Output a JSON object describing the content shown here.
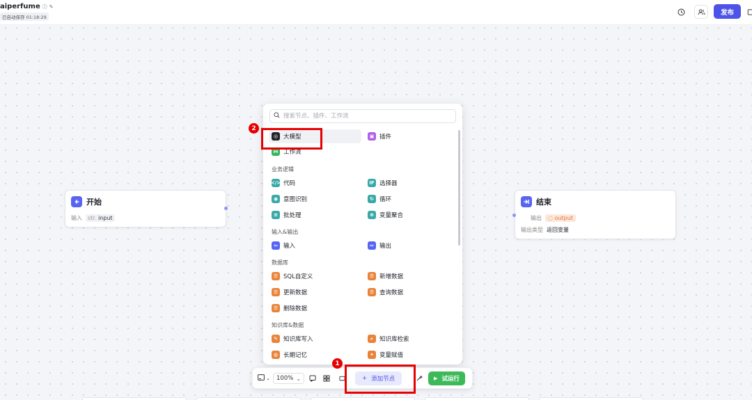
{
  "header": {
    "title": "aiperfume",
    "title_info_icon": "info-icon",
    "title_edit_icon": "edit-icon",
    "autosave": "已自动保存 01:18:29",
    "history_icon": "clock-icon",
    "members_icon": "users-icon",
    "publish_label": "发布"
  },
  "nodes": {
    "start": {
      "title": "开始",
      "input_label": "输入",
      "input_type": "str.",
      "input_name": "input"
    },
    "end": {
      "title": "结束",
      "output_label": "输出",
      "output_var": "output",
      "output_type_label": "输出类型",
      "output_type_value": "返回变量"
    }
  },
  "panel": {
    "search_placeholder": "搜索节点、插件、工作流",
    "items": {
      "llm": "大模型",
      "plugin": "插件",
      "workflow": "工作流",
      "code": "代码",
      "selector": "选择器",
      "intent": "意图识别",
      "loop": "循环",
      "batch": "批处理",
      "var_aggregate": "变量聚合",
      "input": "输入",
      "output": "输出",
      "sql": "SQL自定义",
      "add_data": "新增数据",
      "update_data": "更新数据",
      "query_data": "查询数据",
      "delete_data": "删除数据",
      "kb_write": "知识库写入",
      "kb_search": "知识库检索",
      "memory": "长期记忆",
      "var_assign": "变量赋值"
    },
    "categories": {
      "business_logic": "业务逻辑",
      "io": "输入&输出",
      "database": "数据库",
      "knowledge": "知识库&数据"
    }
  },
  "toolbar": {
    "zoom": "100%",
    "add_node": "添加节点",
    "trial_run": "试运行"
  },
  "annotations": {
    "step1": "1",
    "step2": "2"
  },
  "colors": {
    "accent": "#4d53e8",
    "run_green": "#3db959",
    "annotation_red": "#e60000",
    "orange_icon": "#e8833a"
  }
}
